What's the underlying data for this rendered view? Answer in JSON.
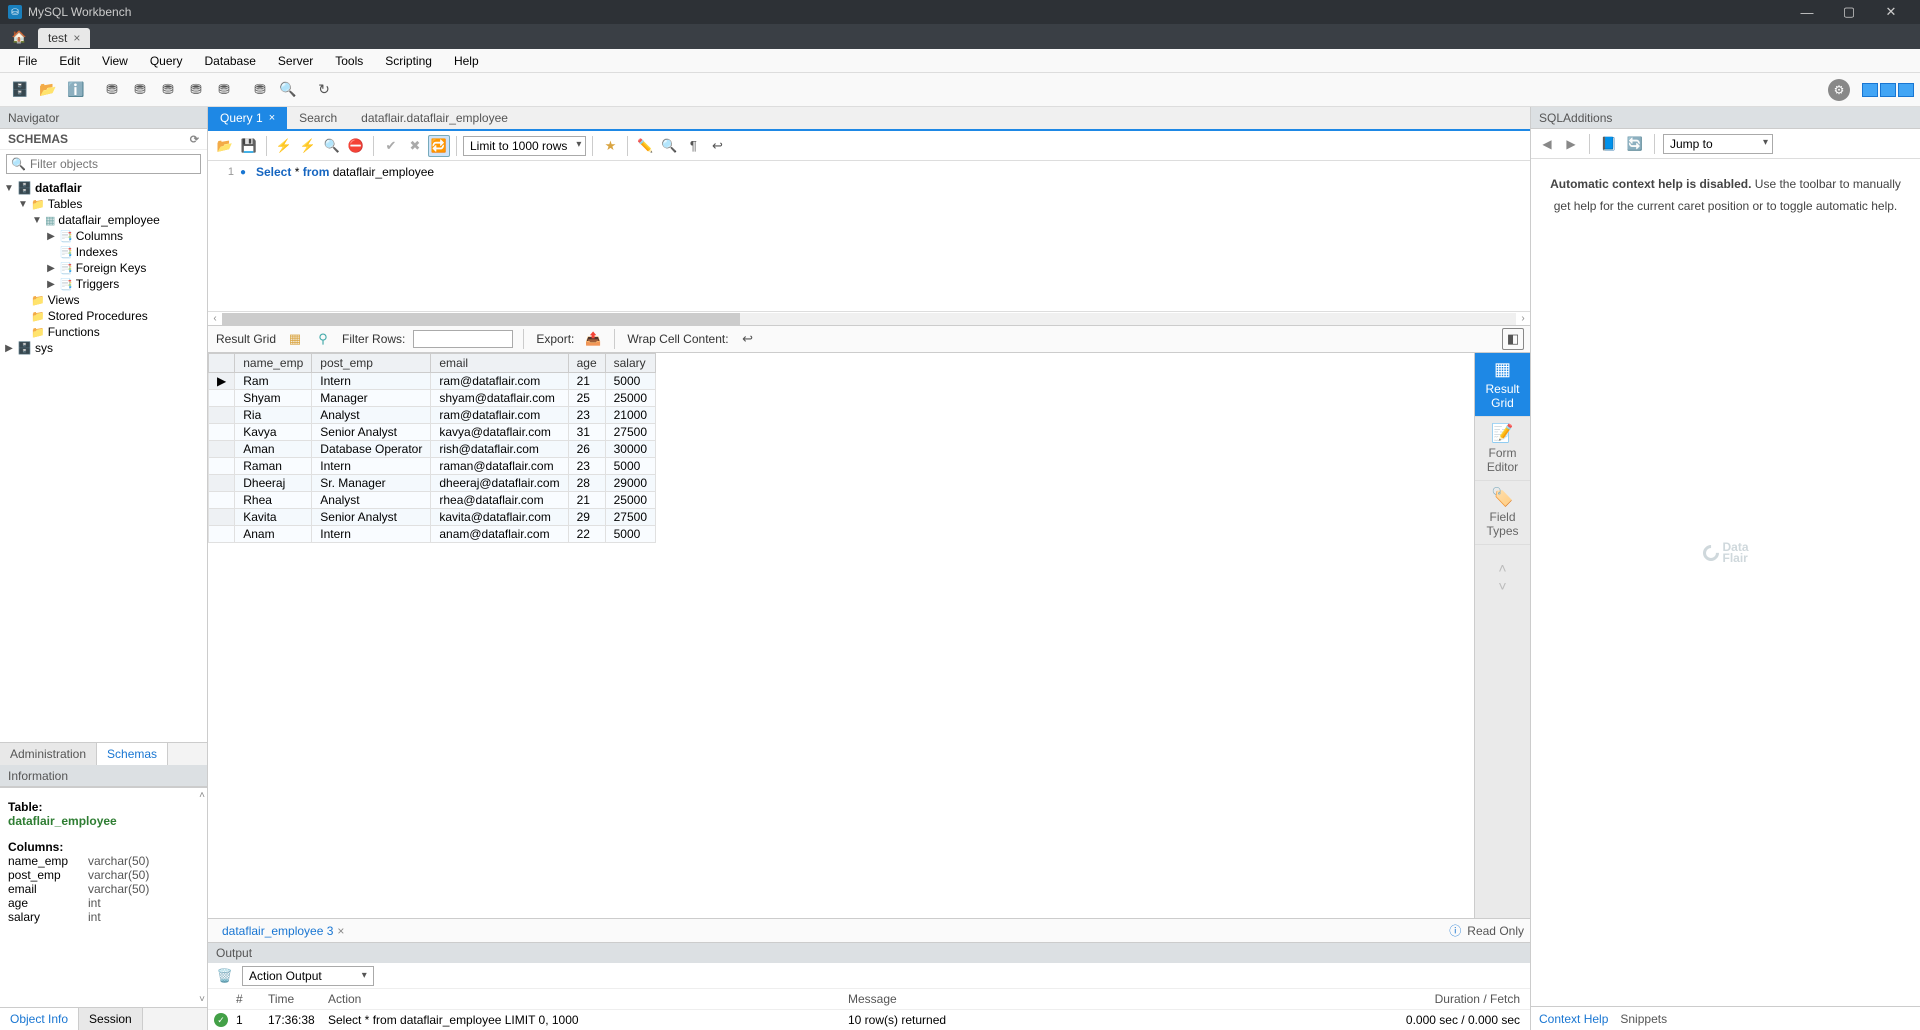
{
  "app": {
    "title": "MySQL Workbench"
  },
  "conn_tab": {
    "label": "test"
  },
  "menu": [
    "File",
    "Edit",
    "View",
    "Query",
    "Database",
    "Server",
    "Tools",
    "Scripting",
    "Help"
  ],
  "nav": {
    "title": "Navigator",
    "schemas_label": "SCHEMAS",
    "filter_placeholder": "Filter objects",
    "tree": {
      "db_dataflair": "dataflair",
      "tables": "Tables",
      "table_employee": "dataflair_employee",
      "columns": "Columns",
      "indexes": "Indexes",
      "foreign_keys": "Foreign Keys",
      "triggers": "Triggers",
      "views": "Views",
      "stored_procs": "Stored Procedures",
      "functions": "Functions",
      "db_sys": "sys"
    },
    "bottom_tabs": {
      "admin": "Administration",
      "schemas": "Schemas"
    },
    "info_header": "Information",
    "info": {
      "table_label": "Table:",
      "table_name": "dataflair_employee",
      "columns_label": "Columns:",
      "cols": [
        {
          "n": "name_emp",
          "t": "varchar(50)"
        },
        {
          "n": "post_emp",
          "t": "varchar(50)"
        },
        {
          "n": "email",
          "t": "varchar(50)"
        },
        {
          "n": "age",
          "t": "int"
        },
        {
          "n": "salary",
          "t": "int"
        }
      ]
    },
    "info_bottom_tabs": {
      "object_info": "Object Info",
      "session": "Session"
    }
  },
  "editor": {
    "tabs": {
      "query1": "Query 1",
      "search": "Search",
      "breadcrumb": "dataflair.dataflair_employee"
    },
    "limit_label": "Limit to 1000 rows",
    "sql": {
      "line_num": "1",
      "kw_select": "Select",
      "star": " * ",
      "kw_from": "from",
      "ident": " dataflair_employee"
    }
  },
  "result": {
    "toolbar": {
      "grid_label": "Result Grid",
      "filter_label": "Filter Rows:",
      "export_label": "Export:",
      "wrap_label": "Wrap Cell Content:"
    },
    "side_tabs": {
      "grid": "Result\nGrid",
      "form": "Form\nEditor",
      "types": "Field\nTypes"
    },
    "headers": [
      "name_emp",
      "post_emp",
      "email",
      "age",
      "salary"
    ],
    "rows": [
      [
        "Ram",
        "Intern",
        "ram@dataflair.com",
        "21",
        "5000"
      ],
      [
        "Shyam",
        "Manager",
        "shyam@dataflair.com",
        "25",
        "25000"
      ],
      [
        "Ria",
        "Analyst",
        "ram@dataflair.com",
        "23",
        "21000"
      ],
      [
        "Kavya",
        "Senior Analyst",
        "kavya@dataflair.com",
        "31",
        "27500"
      ],
      [
        "Aman",
        "Database Operator",
        "rish@dataflair.com",
        "26",
        "30000"
      ],
      [
        "Raman",
        "Intern",
        "raman@dataflair.com",
        "23",
        "5000"
      ],
      [
        "Dheeraj",
        "Sr. Manager",
        "dheeraj@dataflair.com",
        "28",
        "29000"
      ],
      [
        "Rhea",
        "Analyst",
        "rhea@dataflair.com",
        "21",
        "25000"
      ],
      [
        "Kavita",
        "Senior Analyst",
        "kavita@dataflair.com",
        "29",
        "27500"
      ],
      [
        "Anam",
        "Intern",
        "anam@dataflair.com",
        "22",
        "5000"
      ]
    ],
    "bottom_tab": "dataflair_employee 3",
    "readonly_label": "Read Only"
  },
  "output": {
    "header": "Output",
    "mode": "Action Output",
    "cols": {
      "hash": "#",
      "time": "Time",
      "action": "Action",
      "message": "Message",
      "duration": "Duration / Fetch"
    },
    "row": {
      "num": "1",
      "time": "17:36:38",
      "action": "Select * from dataflair_employee LIMIT 0, 1000",
      "message": "10 row(s) returned",
      "duration": "0.000 sec / 0.000 sec"
    }
  },
  "sqla": {
    "header": "SQLAdditions",
    "jump": "Jump to",
    "help_bold": "Automatic context help is disabled.",
    "help_rest": " Use the toolbar to manually get help for the current caret position or to toggle automatic help.",
    "tabs": {
      "context": "Context Help",
      "snippets": "Snippets"
    },
    "watermark": "Data\nFlair"
  }
}
